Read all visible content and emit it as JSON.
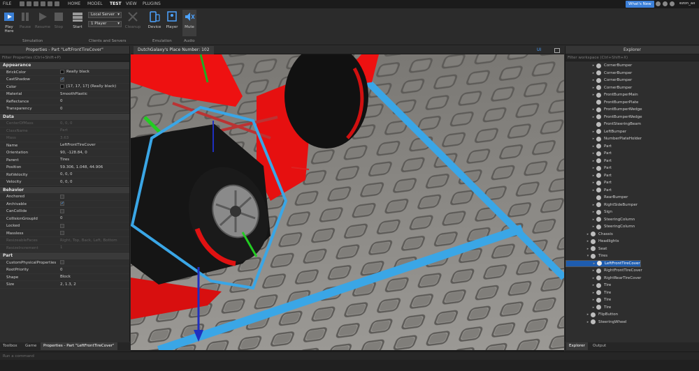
{
  "topbar": {
    "menu": [
      "FILE",
      "HOME",
      "MODEL",
      "TEST",
      "VIEW",
      "PLUGINS"
    ],
    "whats_new": "What's New",
    "user": "ezon_ax"
  },
  "ribbon": {
    "buttons": [
      {
        "label": "Play",
        "sub": "Here"
      },
      {
        "label": "Pause"
      },
      {
        "label": "Resume"
      },
      {
        "label": "Stop"
      },
      {
        "label": "Start"
      },
      {
        "label": "Cleanup"
      },
      {
        "label": "Device"
      },
      {
        "label": "Player"
      },
      {
        "label": "Mute"
      }
    ],
    "server_select": "Local Server",
    "player_select": "1 Player",
    "groups": [
      "Simulation",
      "Clients and Servers",
      "Emulation",
      "Audio"
    ]
  },
  "properties": {
    "title": "Properties - Part \"LeftFrontTireCover\"",
    "filter_placeholder": "Filter Properties (Ctrl+Shift+P)",
    "sections": [
      {
        "name": "Appearance",
        "rows": [
          {
            "k": "BrickColor",
            "v": "Really black",
            "swatch": "#111111"
          },
          {
            "k": "CastShadow",
            "v": "",
            "check": true
          },
          {
            "k": "Color",
            "v": "[17, 17, 17] (Really black)",
            "swatch": "#111111"
          },
          {
            "k": "Material",
            "v": "SmoothPlastic"
          },
          {
            "k": "Reflectance",
            "v": "0"
          },
          {
            "k": "Transparency",
            "v": "0"
          }
        ]
      },
      {
        "name": "Data",
        "rows": [
          {
            "k": "CenterOfMass",
            "v": "0, 0, 0",
            "dim": true
          },
          {
            "k": "ClassName",
            "v": "Part",
            "dim": true
          },
          {
            "k": "Mass",
            "v": "3.63",
            "dim": true
          },
          {
            "k": "Name",
            "v": "LeftFrontTireCover"
          },
          {
            "k": "Orientation",
            "v": "90, -128.84, 0"
          },
          {
            "k": "Parent",
            "v": "Tires"
          },
          {
            "k": "Position",
            "v": "59.306, 1.048, 44.906"
          },
          {
            "k": "RotVelocity",
            "v": "0, 0, 0"
          },
          {
            "k": "Velocity",
            "v": "0, 0, 0"
          }
        ]
      },
      {
        "name": "Behavior",
        "rows": [
          {
            "k": "Anchored",
            "v": "",
            "check": false
          },
          {
            "k": "Archivable",
            "v": "",
            "check": true
          },
          {
            "k": "CanCollide",
            "v": "",
            "check": false
          },
          {
            "k": "CollisionGroupId",
            "v": "0"
          },
          {
            "k": "Locked",
            "v": "",
            "check": false
          },
          {
            "k": "Massless",
            "v": "",
            "check": false
          },
          {
            "k": "ResizeableFaces",
            "v": "Right, Top, Back, Left, Bottom",
            "dim": true
          },
          {
            "k": "ResizeIncrement",
            "v": "1",
            "dim": true
          }
        ]
      },
      {
        "name": "Part",
        "rows": [
          {
            "k": "CustomPhysicalProperties",
            "v": "",
            "check": false
          },
          {
            "k": "RootPriority",
            "v": "0"
          },
          {
            "k": "Shape",
            "v": "Block"
          },
          {
            "k": "Size",
            "v": "2, 1.3, 2"
          }
        ]
      }
    ]
  },
  "viewport": {
    "tab": "DutchGalaxy's Place Number: 102",
    "ui_toggle": "UI"
  },
  "explorer": {
    "title": "Explorer",
    "filter_placeholder": "Filter workspace (Ctrl+Shift+X)",
    "items": [
      {
        "label": "CornerBumper",
        "depth": 2,
        "expand": "▸"
      },
      {
        "label": "CornerBumper",
        "depth": 2,
        "expand": "▸"
      },
      {
        "label": "CornerBumper",
        "depth": 2,
        "expand": "▸"
      },
      {
        "label": "CornerBumper",
        "depth": 2,
        "expand": "▸"
      },
      {
        "label": "FrontBumperMain",
        "depth": 2,
        "expand": "▸"
      },
      {
        "label": "FrontBumperPlate",
        "depth": 2,
        "expand": ""
      },
      {
        "label": "FrontBumperWedge",
        "depth": 2,
        "expand": "▸"
      },
      {
        "label": "FrontBumperWedge",
        "depth": 2,
        "expand": "▸"
      },
      {
        "label": "FrontSteeringBeam",
        "depth": 2,
        "expand": ""
      },
      {
        "label": "LeftBumper",
        "depth": 2,
        "expand": "▸"
      },
      {
        "label": "NumberPlateHolder",
        "depth": 2,
        "expand": "▸"
      },
      {
        "label": "Part",
        "depth": 2,
        "expand": "▸"
      },
      {
        "label": "Part",
        "depth": 2,
        "expand": "▸"
      },
      {
        "label": "Part",
        "depth": 2,
        "expand": "▸"
      },
      {
        "label": "Part",
        "depth": 2,
        "expand": "▸"
      },
      {
        "label": "Part",
        "depth": 2,
        "expand": "▸"
      },
      {
        "label": "Part",
        "depth": 2,
        "expand": "▸"
      },
      {
        "label": "Part",
        "depth": 2,
        "expand": "▸"
      },
      {
        "label": "RearBumper",
        "depth": 2,
        "expand": ""
      },
      {
        "label": "RightSideBumper",
        "depth": 2,
        "expand": "▸"
      },
      {
        "label": "Sign",
        "depth": 2,
        "expand": "▸"
      },
      {
        "label": "SteeringColumn",
        "depth": 2,
        "expand": "▸"
      },
      {
        "label": "SteeringColumn",
        "depth": 2,
        "expand": "▸"
      },
      {
        "label": "Chassis",
        "depth": 1,
        "expand": "▸"
      },
      {
        "label": "Headlights",
        "depth": 1,
        "expand": "▸"
      },
      {
        "label": "Seat",
        "depth": 1,
        "expand": "▸"
      },
      {
        "label": "Tires",
        "depth": 1,
        "expand": "▾"
      },
      {
        "label": "LeftFrontTireCover",
        "depth": 2,
        "expand": "▸",
        "selected": true
      },
      {
        "label": "LeftRearTireCover",
        "depth": 2,
        "expand": "▸"
      },
      {
        "label": "RightFrontTireCover",
        "depth": 2,
        "expand": "▸"
      },
      {
        "label": "RightRearTireCover",
        "depth": 2,
        "expand": "▸"
      },
      {
        "label": "Tire",
        "depth": 2,
        "expand": "▸"
      },
      {
        "label": "Tire",
        "depth": 2,
        "expand": "▸"
      },
      {
        "label": "Tire",
        "depth": 2,
        "expand": "▸"
      },
      {
        "label": "Tire",
        "depth": 2,
        "expand": "▸"
      },
      {
        "label": "FlipButton",
        "depth": 1,
        "expand": "▸"
      },
      {
        "label": "SteeringWheel",
        "depth": 1,
        "expand": "▸"
      }
    ]
  },
  "bottom_tabs_left": [
    "Toolbox",
    "Game",
    "Properties - Part \"LeftFrontTireCover\""
  ],
  "bottom_tabs_right": [
    "Explorer",
    "Output"
  ],
  "command_bar_placeholder": "Run a command",
  "colors": {
    "selection_blue": "#1e5cae",
    "accent_blue": "#3c80d9",
    "highlight_cyan": "#3aa6e6",
    "car_red": "#ee1111"
  }
}
